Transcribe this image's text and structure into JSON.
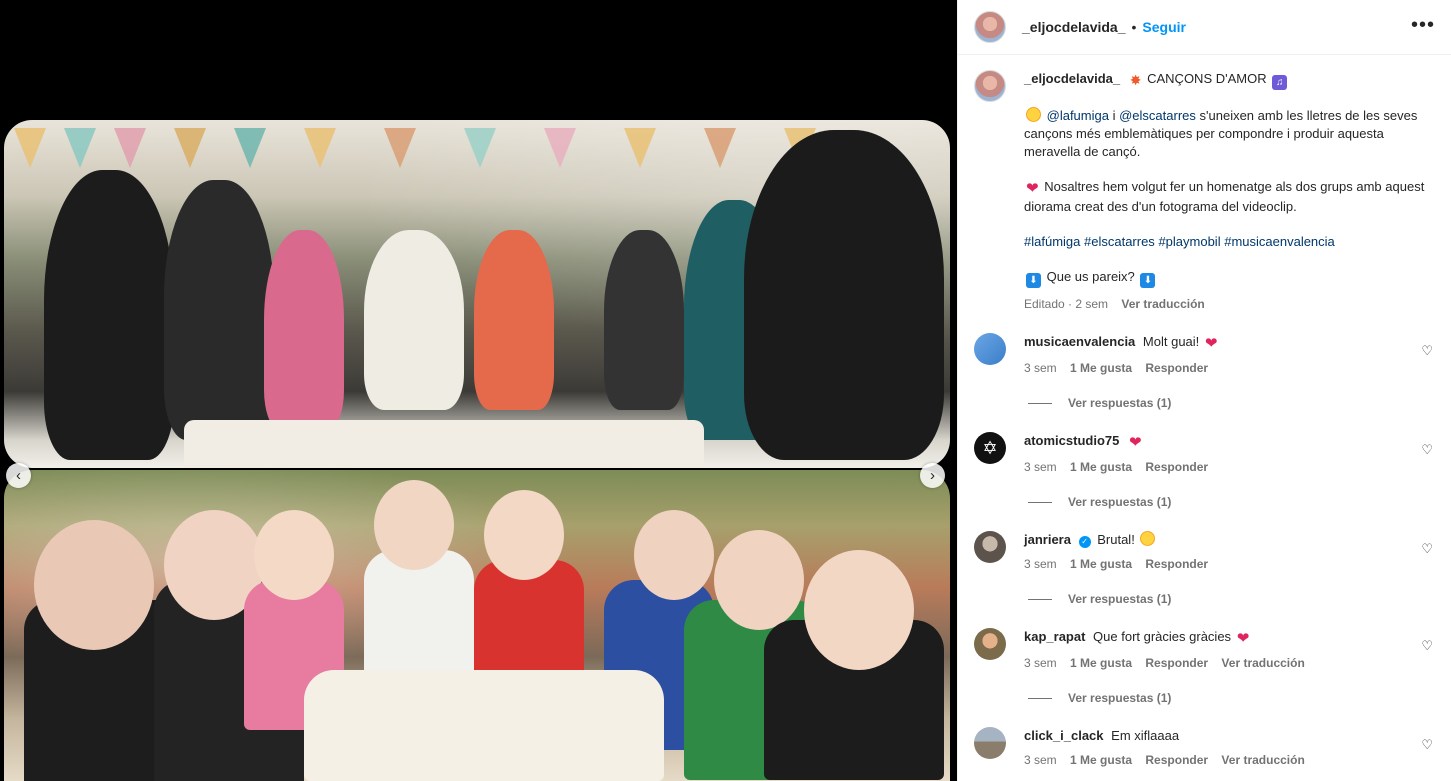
{
  "post": {
    "username": "_eljocdelavida_",
    "follow_label": "Seguir",
    "separator": "•",
    "more_label": "•••",
    "caption": {
      "title": "CANÇONS D'AMOR",
      "mention1": "@lafumiga",
      "conj": "i",
      "mention2": "@elscatarres",
      "para1_rest": "s'uneixen amb les lletres de les seves cançons més emblemàtiques per compondre i produir aquesta meravella de cançó.",
      "para2": "Nosaltres hem volgut fer un homenatge als dos grups amb aquest diorama creat des d'un fotograma del videoclip.",
      "hashtags": [
        "#lafúmiga",
        "#elscatarres",
        "#playmobil",
        "#musicaenvalencia"
      ],
      "question": "Que us pareix?",
      "edited": "Editado · 2 sem",
      "translate": "Ver traducción"
    },
    "nav": {
      "prev": "‹",
      "next": "›"
    }
  },
  "comments": [
    {
      "user": "musicaenvalencia",
      "text": "Molt guai!",
      "emoji": "heart",
      "time": "3 sem",
      "likes": "1 Me gusta",
      "reply": "Responder",
      "translate": "",
      "view_replies": "Ver respuestas (1)",
      "verified": false
    },
    {
      "user": "atomicstudio75",
      "text": "",
      "emoji": "heart",
      "time": "3 sem",
      "likes": "1 Me gusta",
      "reply": "Responder",
      "translate": "",
      "view_replies": "Ver respuestas (1)",
      "verified": false
    },
    {
      "user": "janriera",
      "text": "Brutal!",
      "emoji": "star-eyes",
      "time": "3 sem",
      "likes": "1 Me gusta",
      "reply": "Responder",
      "translate": "",
      "view_replies": "Ver respuestas (1)",
      "verified": true
    },
    {
      "user": "kap_rapat",
      "text": "Que fort gràcies gràcies",
      "emoji": "heart",
      "time": "3 sem",
      "likes": "1 Me gusta",
      "reply": "Responder",
      "translate": "Ver traducción",
      "view_replies": "Ver respuestas (1)",
      "verified": false
    },
    {
      "user": "click_i_clack",
      "text": "Em xiflaaaa",
      "emoji": "",
      "time": "3 sem",
      "likes": "1 Me gusta",
      "reply": "Responder",
      "translate": "Ver traducción",
      "view_replies": "",
      "verified": false
    }
  ],
  "icons": {
    "more": "more-horizontal-icon",
    "like": "heart-outline-icon",
    "prev": "chevron-left-icon",
    "next": "chevron-right-icon"
  },
  "colors": {
    "link": "#0095f6",
    "tag": "#00376b",
    "muted": "#737373"
  }
}
